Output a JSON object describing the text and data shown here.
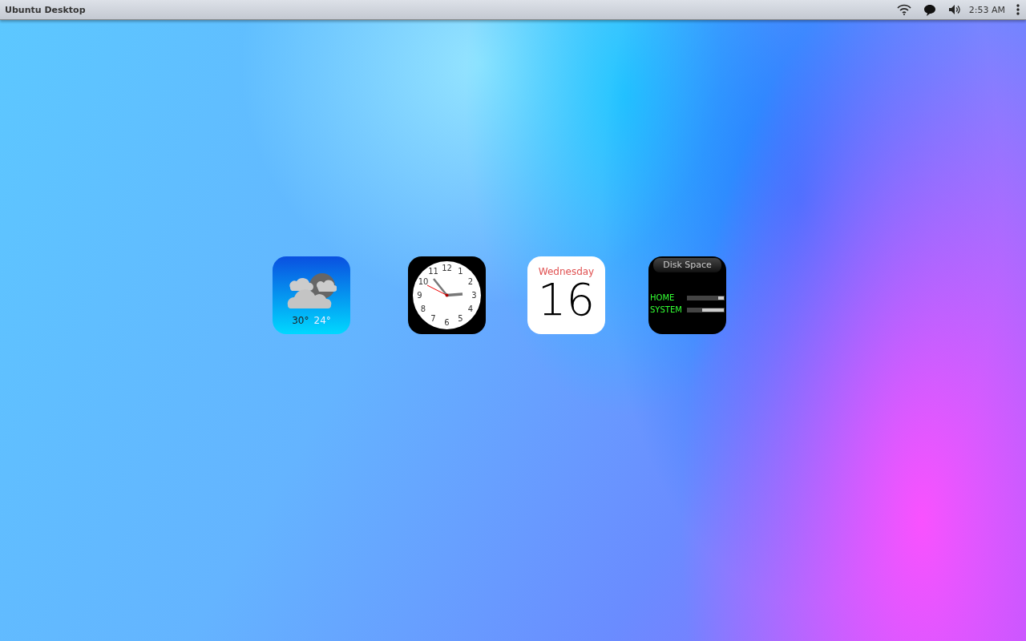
{
  "top_bar": {
    "title": "Ubuntu Desktop",
    "time": "2:53 AM"
  },
  "weather": {
    "high": "30°",
    "low": "24°"
  },
  "clock": {
    "numerals": [
      "11",
      "12",
      "1",
      "10",
      "2",
      "9",
      "3",
      "8",
      "4",
      "7",
      "6",
      "5"
    ]
  },
  "calendar": {
    "weekday": "Wednesday",
    "day": "16"
  },
  "disk_space": {
    "title": "Disk Space",
    "drives": [
      {
        "name": "HOME",
        "level": 0.15
      },
      {
        "name": "SYSTEM",
        "level": 0.6
      }
    ]
  }
}
